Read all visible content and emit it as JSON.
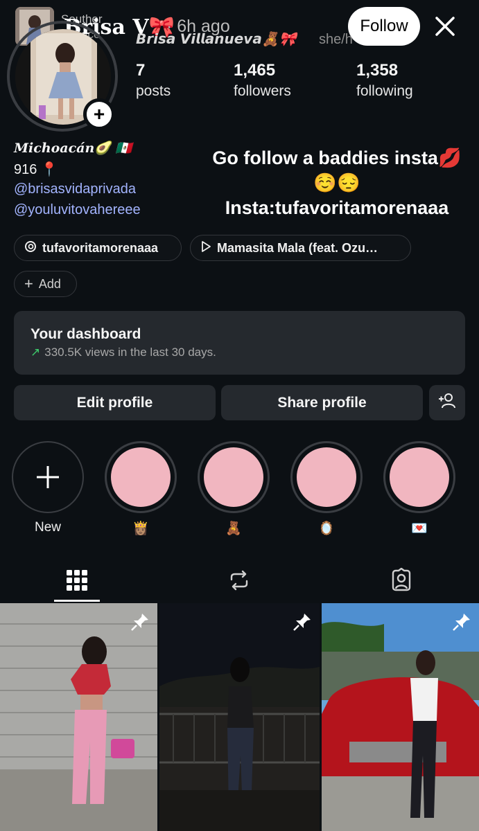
{
  "story_bar": {
    "overlay_label_1": "Souther",
    "overlay_label_2": "Menace",
    "name": "Brisa V🎀",
    "time": "· 6h ago",
    "follow_label": "Follow",
    "close_icon": "close-icon"
  },
  "profile": {
    "display_name": "𝘽𝙧𝙞𝙨𝙖 𝙑𝙞𝙡𝙡𝙖𝙣𝙪𝙚𝙫𝙖🧸🎀",
    "pronouns": "she/h",
    "stats": [
      {
        "value": "7",
        "label": "posts"
      },
      {
        "value": "1,465",
        "label": "followers"
      },
      {
        "value": "1,358",
        "label": "following"
      }
    ]
  },
  "bio": {
    "line1": "𝑴𝒊𝒄𝒉𝒐𝒂𝒄𝒂́𝒏🥑 🇲🇽",
    "line2": "916 📍",
    "links": [
      "@brisasvidaprivada",
      "@youluvitovahereee"
    ],
    "promo_line1": "Go follow a baddies insta💋",
    "promo_line2": "☺️😔",
    "promo_line3": "Insta:tufavoritamorenaaa"
  },
  "chips": {
    "threads": {
      "icon": "threads-icon",
      "label": "tufavoritamorenaaa"
    },
    "music": {
      "icon": "play-icon",
      "label": "Mamasita Mala (feat. Ozu…"
    },
    "add": {
      "icon": "plus-icon",
      "label": "Add"
    }
  },
  "dashboard": {
    "title": "Your dashboard",
    "subtitle": "330.5K views in the last 30 days.",
    "trend_color": "#3ecb6c"
  },
  "actions": {
    "edit_label": "Edit profile",
    "share_label": "Share profile",
    "add_person_icon": "add-person-icon"
  },
  "highlights": [
    {
      "label": "New",
      "type": "new"
    },
    {
      "label": "👸🏽",
      "color": "#f1b6c0"
    },
    {
      "label": "🧸",
      "color": "#f1b6c0"
    },
    {
      "label": "🪞",
      "color": "#f1b6c0"
    },
    {
      "label": "💌",
      "color": "#f1b6c0"
    }
  ],
  "tabs": [
    {
      "icon": "grid-icon",
      "active": true
    },
    {
      "icon": "reposts-icon",
      "active": false
    },
    {
      "icon": "tagged-icon",
      "active": false
    }
  ],
  "posts": [
    {
      "pinned": true,
      "scene": "wall-outfit"
    },
    {
      "pinned": true,
      "scene": "night-view"
    },
    {
      "pinned": true,
      "scene": "red-car"
    }
  ]
}
